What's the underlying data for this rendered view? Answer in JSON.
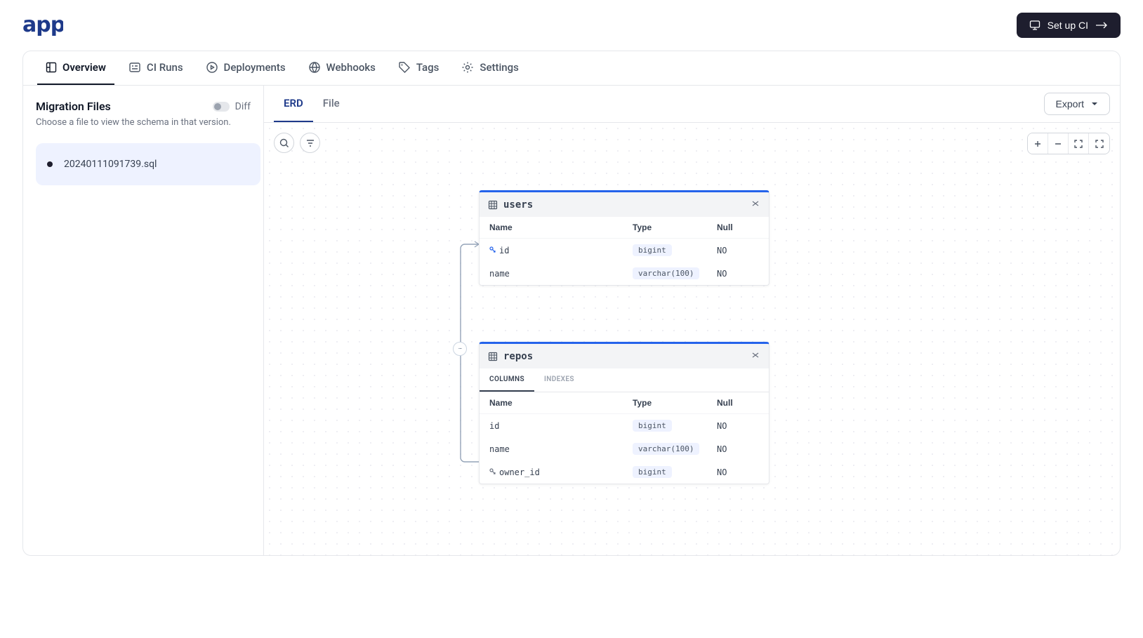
{
  "header": {
    "logo_text": "app",
    "setup_ci": "Set up CI"
  },
  "nav": {
    "overview": "Overview",
    "ci_runs": "CI Runs",
    "deployments": "Deployments",
    "webhooks": "Webhooks",
    "tags": "Tags",
    "settings": "Settings"
  },
  "sidebar": {
    "title": "Migration Files",
    "subtitle": "Choose a file to view the schema in that version.",
    "diff_label": "Diff",
    "files": [
      {
        "name": "20240111091739.sql"
      }
    ]
  },
  "content": {
    "view_tabs": {
      "erd": "ERD",
      "file": "File"
    },
    "export": "Export"
  },
  "tables": {
    "users": {
      "name": "users",
      "headers": {
        "name": "Name",
        "type": "Type",
        "null": "Null"
      },
      "rows": [
        {
          "name": "id",
          "type": "bigint",
          "null": "NO",
          "pk": true
        },
        {
          "name": "name",
          "type": "varchar(100)",
          "null": "NO"
        }
      ]
    },
    "repos": {
      "name": "repos",
      "sub_tabs": {
        "columns": "COLUMNS",
        "indexes": "INDEXES"
      },
      "headers": {
        "name": "Name",
        "type": "Type",
        "null": "Null"
      },
      "rows": [
        {
          "name": "id",
          "type": "bigint",
          "null": "NO"
        },
        {
          "name": "name",
          "type": "varchar(100)",
          "null": "NO"
        },
        {
          "name": "owner_id",
          "type": "bigint",
          "null": "NO",
          "fk": true
        }
      ]
    }
  }
}
